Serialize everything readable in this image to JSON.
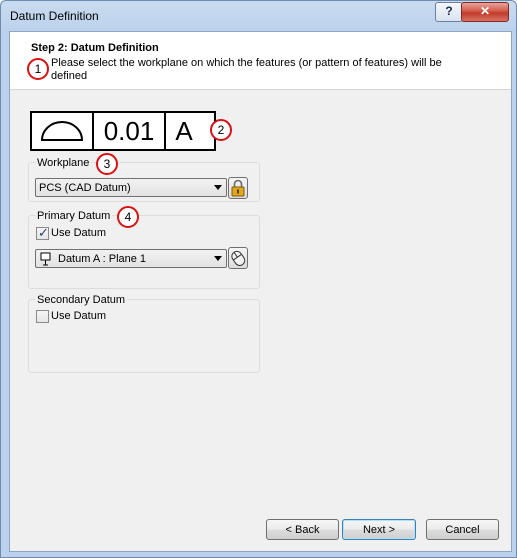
{
  "window": {
    "title": "Datum Definition",
    "help_label": "?",
    "close_label": "✕"
  },
  "header": {
    "step_title": "Step 2: Datum Definition",
    "description": "Please select the workplane on which the features (or pattern of features) will be defined"
  },
  "badges": [
    "1",
    "2",
    "3",
    "4"
  ],
  "feature_control_frame": {
    "symbol_icon": "profile-of-surface-icon",
    "tolerance": "0.01",
    "datum": "A"
  },
  "workplane": {
    "label": "Workplane",
    "selected": "PCS (CAD Datum)",
    "lock_icon": "lock-icon"
  },
  "primary_datum": {
    "label": "Primary Datum",
    "use_datum_label": "Use Datum",
    "use_datum_checked": true,
    "selected": "Datum A : Plane 1",
    "plane_icon": "datum-plane-icon",
    "pick_icon": "mouse-pick-icon"
  },
  "secondary_datum": {
    "label": "Secondary Datum",
    "use_datum_label": "Use Datum",
    "use_datum_checked": false
  },
  "footer": {
    "back_label": "< Back",
    "next_label": "Next >",
    "cancel_label": "Cancel"
  },
  "colors": {
    "badge_ring": "#dd1111",
    "lock_accent": "#e0a81e",
    "title_bar": "#bcd2ec"
  }
}
